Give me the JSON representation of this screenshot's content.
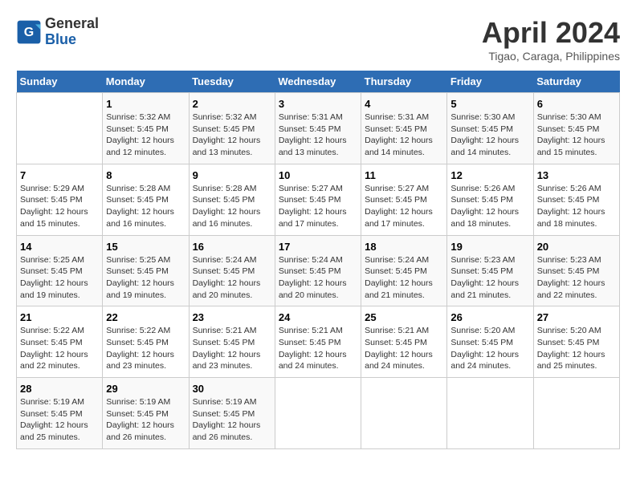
{
  "header": {
    "logo_line1": "General",
    "logo_line2": "Blue",
    "month_title": "April 2024",
    "location": "Tigao, Caraga, Philippines"
  },
  "days_of_week": [
    "Sunday",
    "Monday",
    "Tuesday",
    "Wednesday",
    "Thursday",
    "Friday",
    "Saturday"
  ],
  "weeks": [
    [
      {
        "day": "",
        "info": ""
      },
      {
        "day": "1",
        "info": "Sunrise: 5:32 AM\nSunset: 5:45 PM\nDaylight: 12 hours\nand 12 minutes."
      },
      {
        "day": "2",
        "info": "Sunrise: 5:32 AM\nSunset: 5:45 PM\nDaylight: 12 hours\nand 13 minutes."
      },
      {
        "day": "3",
        "info": "Sunrise: 5:31 AM\nSunset: 5:45 PM\nDaylight: 12 hours\nand 13 minutes."
      },
      {
        "day": "4",
        "info": "Sunrise: 5:31 AM\nSunset: 5:45 PM\nDaylight: 12 hours\nand 14 minutes."
      },
      {
        "day": "5",
        "info": "Sunrise: 5:30 AM\nSunset: 5:45 PM\nDaylight: 12 hours\nand 14 minutes."
      },
      {
        "day": "6",
        "info": "Sunrise: 5:30 AM\nSunset: 5:45 PM\nDaylight: 12 hours\nand 15 minutes."
      }
    ],
    [
      {
        "day": "7",
        "info": "Sunrise: 5:29 AM\nSunset: 5:45 PM\nDaylight: 12 hours\nand 15 minutes."
      },
      {
        "day": "8",
        "info": "Sunrise: 5:28 AM\nSunset: 5:45 PM\nDaylight: 12 hours\nand 16 minutes."
      },
      {
        "day": "9",
        "info": "Sunrise: 5:28 AM\nSunset: 5:45 PM\nDaylight: 12 hours\nand 16 minutes."
      },
      {
        "day": "10",
        "info": "Sunrise: 5:27 AM\nSunset: 5:45 PM\nDaylight: 12 hours\nand 17 minutes."
      },
      {
        "day": "11",
        "info": "Sunrise: 5:27 AM\nSunset: 5:45 PM\nDaylight: 12 hours\nand 17 minutes."
      },
      {
        "day": "12",
        "info": "Sunrise: 5:26 AM\nSunset: 5:45 PM\nDaylight: 12 hours\nand 18 minutes."
      },
      {
        "day": "13",
        "info": "Sunrise: 5:26 AM\nSunset: 5:45 PM\nDaylight: 12 hours\nand 18 minutes."
      }
    ],
    [
      {
        "day": "14",
        "info": "Sunrise: 5:25 AM\nSunset: 5:45 PM\nDaylight: 12 hours\nand 19 minutes."
      },
      {
        "day": "15",
        "info": "Sunrise: 5:25 AM\nSunset: 5:45 PM\nDaylight: 12 hours\nand 19 minutes."
      },
      {
        "day": "16",
        "info": "Sunrise: 5:24 AM\nSunset: 5:45 PM\nDaylight: 12 hours\nand 20 minutes."
      },
      {
        "day": "17",
        "info": "Sunrise: 5:24 AM\nSunset: 5:45 PM\nDaylight: 12 hours\nand 20 minutes."
      },
      {
        "day": "18",
        "info": "Sunrise: 5:24 AM\nSunset: 5:45 PM\nDaylight: 12 hours\nand 21 minutes."
      },
      {
        "day": "19",
        "info": "Sunrise: 5:23 AM\nSunset: 5:45 PM\nDaylight: 12 hours\nand 21 minutes."
      },
      {
        "day": "20",
        "info": "Sunrise: 5:23 AM\nSunset: 5:45 PM\nDaylight: 12 hours\nand 22 minutes."
      }
    ],
    [
      {
        "day": "21",
        "info": "Sunrise: 5:22 AM\nSunset: 5:45 PM\nDaylight: 12 hours\nand 22 minutes."
      },
      {
        "day": "22",
        "info": "Sunrise: 5:22 AM\nSunset: 5:45 PM\nDaylight: 12 hours\nand 23 minutes."
      },
      {
        "day": "23",
        "info": "Sunrise: 5:21 AM\nSunset: 5:45 PM\nDaylight: 12 hours\nand 23 minutes."
      },
      {
        "day": "24",
        "info": "Sunrise: 5:21 AM\nSunset: 5:45 PM\nDaylight: 12 hours\nand 24 minutes."
      },
      {
        "day": "25",
        "info": "Sunrise: 5:21 AM\nSunset: 5:45 PM\nDaylight: 12 hours\nand 24 minutes."
      },
      {
        "day": "26",
        "info": "Sunrise: 5:20 AM\nSunset: 5:45 PM\nDaylight: 12 hours\nand 24 minutes."
      },
      {
        "day": "27",
        "info": "Sunrise: 5:20 AM\nSunset: 5:45 PM\nDaylight: 12 hours\nand 25 minutes."
      }
    ],
    [
      {
        "day": "28",
        "info": "Sunrise: 5:19 AM\nSunset: 5:45 PM\nDaylight: 12 hours\nand 25 minutes."
      },
      {
        "day": "29",
        "info": "Sunrise: 5:19 AM\nSunset: 5:45 PM\nDaylight: 12 hours\nand 26 minutes."
      },
      {
        "day": "30",
        "info": "Sunrise: 5:19 AM\nSunset: 5:45 PM\nDaylight: 12 hours\nand 26 minutes."
      },
      {
        "day": "",
        "info": ""
      },
      {
        "day": "",
        "info": ""
      },
      {
        "day": "",
        "info": ""
      },
      {
        "day": "",
        "info": ""
      }
    ]
  ]
}
